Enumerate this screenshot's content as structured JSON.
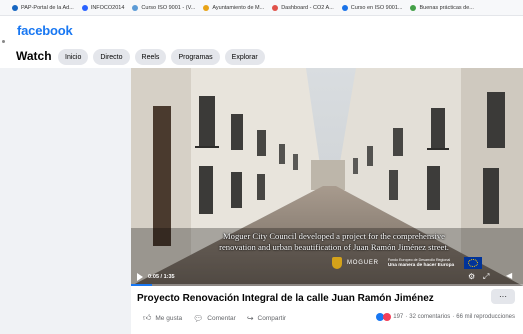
{
  "bookmarks": [
    {
      "label": "PAP-Portal de la Ad...",
      "color": "#1565c0"
    },
    {
      "label": "INFOCO2014",
      "color": "#2962ff"
    },
    {
      "label": "Curso ISO 9001 - (V...",
      "color": "#5c9bd6"
    },
    {
      "label": "Ayuntamiento de M...",
      "color": "#e8a317"
    },
    {
      "label": "Dashboard - CO2 A...",
      "color": "#e0524a"
    },
    {
      "label": "Curso en ISO 9001...",
      "color": "#1a73e8"
    },
    {
      "label": "Buenas prácticas de...",
      "color": "#43a047"
    }
  ],
  "header": {
    "logo": "facebook",
    "brand_color": "#1877f2"
  },
  "watch": {
    "title": "Watch",
    "tabs": [
      "Inicio",
      "Directo",
      "Reels",
      "Programas",
      "Explorar"
    ]
  },
  "video": {
    "caption_line1": "Moguer City Council developed a project for the comprehensive",
    "caption_line2": "renovation and urban beautification of Juan Ramón Jiménez street.",
    "time": "0:05 / 1:35",
    "progress": 0.053,
    "brand_moguer": "MOGUER",
    "fondo_line1": "Fondo Europeo de Desarrollo Regional",
    "fondo_line2": "Una manera de hacer Europa"
  },
  "post": {
    "title": "Proyecto Renovación Integral de la calle Juan Ramón Jiménez",
    "more": "···",
    "like": "Me gusta",
    "comment": "Comentar",
    "share": "Compartir",
    "reactions_count": "197",
    "comments": "32 comentarios",
    "views": "66 mil reproducciones",
    "separator": "·"
  }
}
